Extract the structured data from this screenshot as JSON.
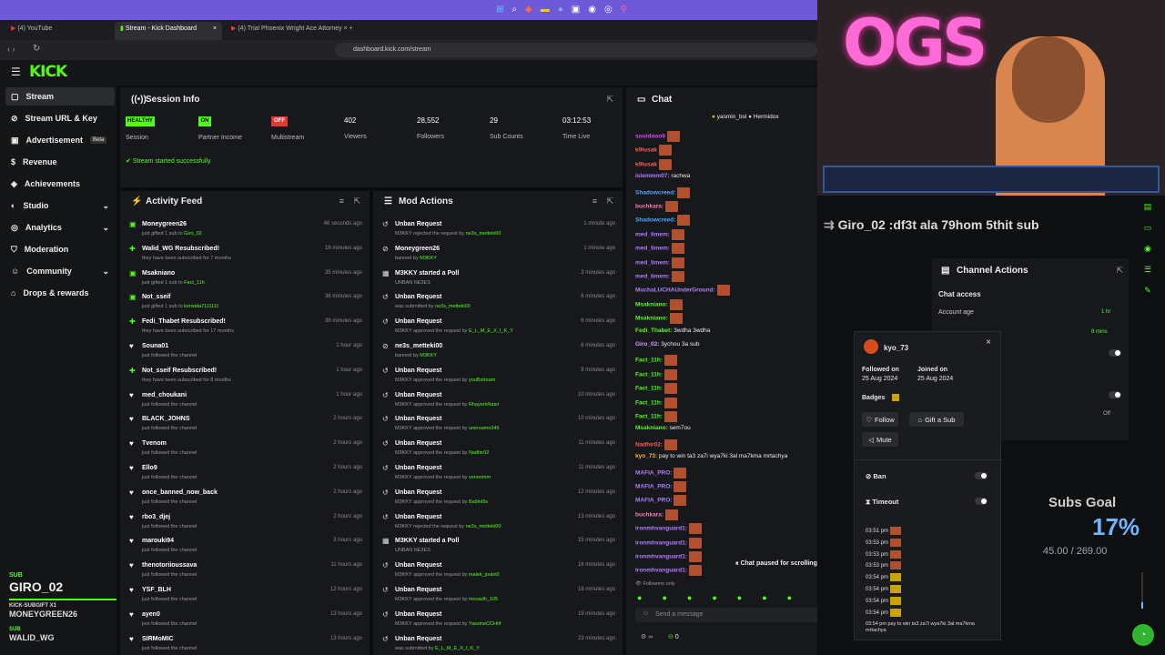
{
  "browser": {
    "tabs": [
      "(4) YouTube",
      "Stream - Kick Dashboard",
      "(4) Trial Phoenix Wright Ace Attorney"
    ],
    "url": "dashboard.kick.com/stream"
  },
  "brand": {
    "logo": "KICK",
    "accent": "#53fc18"
  },
  "sidebar": {
    "items": [
      {
        "label": "Stream"
      },
      {
        "label": "Stream URL & Key"
      },
      {
        "label": "Advertisement",
        "badge": "Beta"
      },
      {
        "label": "Revenue"
      },
      {
        "label": "Achievements"
      },
      {
        "label": "Studio"
      },
      {
        "label": "Analytics"
      },
      {
        "label": "Moderation"
      },
      {
        "label": "Community"
      },
      {
        "label": "Drops & rewards"
      }
    ]
  },
  "session": {
    "title": "Session Info",
    "stats": [
      {
        "badge": "HEALTHY",
        "label": "Session"
      },
      {
        "badge": "ON",
        "label": "Partner Income"
      },
      {
        "badge": "OFF",
        "label": "Multistream"
      },
      {
        "value": "402",
        "label": "Viewers"
      },
      {
        "value": "28,552",
        "label": "Followers"
      },
      {
        "value": "29",
        "label": "Sub Counts"
      },
      {
        "value": "03:12:53",
        "label": "Time Live"
      }
    ],
    "status": "Stream started successfully."
  },
  "activity": {
    "title": "Activity Feed",
    "rows": [
      {
        "t": "Moneygreen26",
        "s": "just gifted 1 sub to",
        "h": "Giro_02",
        "time": "46 seconds ago"
      },
      {
        "t": "Walid_WG Resubscribed!",
        "s": "they have been subscribed for 7 months",
        "time": "18 minutes ago"
      },
      {
        "t": "Msakniano",
        "s": "just gifted 1 sub to",
        "h": "Fact_11h",
        "time": "35 minutes ago"
      },
      {
        "t": "Not_sseif",
        "s": "just gifted 1 sub to",
        "h": "kerwida7111111",
        "time": "38 minutes ago"
      },
      {
        "t": "Fedi_Thabet Resubscribed!",
        "s": "they have been subscribed for 17 months",
        "time": "38 minutes ago"
      },
      {
        "t": "Souna01",
        "s": "just followed the channel",
        "time": "1 hour ago"
      },
      {
        "t": "Not_sseif Resubscribed!",
        "s": "they have been subscribed for 8 months",
        "time": "1 hour ago"
      },
      {
        "t": "med_choukani",
        "s": "just followed the channel",
        "time": "1 hour ago"
      },
      {
        "t": "BLACK_JOHNS",
        "s": "just followed the channel",
        "time": "2 hours ago"
      },
      {
        "t": "Tvenom",
        "s": "just followed the channel",
        "time": "2 hours ago"
      },
      {
        "t": "Ello9",
        "s": "just followed the channel",
        "time": "2 hours ago"
      },
      {
        "t": "once_banned_now_back",
        "s": "just followed the channel",
        "time": "2 hours ago"
      },
      {
        "t": "rbo3_djej",
        "s": "just followed the channel",
        "time": "2 hours ago"
      },
      {
        "t": "marouki94",
        "s": "just followed the channel",
        "time": "3 hours ago"
      },
      {
        "t": "thenotoriioussava",
        "s": "just followed the channel",
        "time": "11 hours ago"
      },
      {
        "t": "YSF_BLH",
        "s": "just followed the channel",
        "time": "12 hours ago"
      },
      {
        "t": "ayen0",
        "s": "just followed the channel",
        "time": "13 hours ago"
      },
      {
        "t": "SIRMoMIC",
        "s": "just followed the channel",
        "time": "13 hours ago"
      }
    ]
  },
  "mod": {
    "title": "Mod Actions",
    "rows": [
      {
        "t": "Unban Request",
        "s": "M3KKY rejected the request by",
        "h": "ne3s_metteki00",
        "time": "1 minute ago"
      },
      {
        "t": "Moneygreen26",
        "s": "banned by",
        "h": "M3KKY",
        "time": "1 minute ago"
      },
      {
        "t": "M3KKY started a Poll",
        "s": "UNBAN NE3ES",
        "time": "3 minutes ago"
      },
      {
        "t": "Unban Request",
        "s": "was submitted by",
        "h": "ne3s_metteki00",
        "time": "6 minutes ago"
      },
      {
        "t": "Unban Request",
        "s": "M3KKY approved the request by",
        "h": "E_L_M_E_X_I_K_Y",
        "time": "6 minutes ago"
      },
      {
        "t": "ne3s_metteki00",
        "s": "banned by",
        "h": "M3KKY",
        "time": "6 minutes ago"
      },
      {
        "t": "Unban Request",
        "s": "M3KKY approved the request by",
        "h": "youBstream",
        "time": "9 minutes ago"
      },
      {
        "t": "Unban Request",
        "s": "M3KKY approved the request by",
        "h": "RhayemNasri",
        "time": "10 minutes ago"
      },
      {
        "t": "Unban Request",
        "s": "M3KKY approved the request by",
        "h": "unersame345",
        "time": "10 minutes ago"
      },
      {
        "t": "Unban Request",
        "s": "M3KKY approved the request by",
        "h": "Nadhir02",
        "time": "11 minutes ago"
      },
      {
        "t": "Unban Request",
        "s": "M3KKY approved the request by",
        "h": "venoomm",
        "time": "11 minutes ago"
      },
      {
        "t": "Unban Request",
        "s": "M3KKY approved the request by",
        "h": "Ba9ini9s",
        "time": "12 minutes ago"
      },
      {
        "t": "Unban Request",
        "s": "M3KKY rejected the request by",
        "h": "ne3s_metteki00",
        "time": "13 minutes ago"
      },
      {
        "t": "M3KKY started a Poll",
        "s": "UNBAN NE3ES",
        "time": "15 minutes ago"
      },
      {
        "t": "Unban Request",
        "s": "M3KKY approved the request by",
        "h": "malek_jouini0",
        "time": "16 minutes ago"
      },
      {
        "t": "Unban Request",
        "s": "M3KKY approved the request by",
        "h": "mouadh_105",
        "time": "18 minutes ago"
      },
      {
        "t": "Unban Request",
        "s": "M3KKY approved the request by",
        "h": "YassineCCHrif",
        "time": "19 minutes ago"
      },
      {
        "t": "Unban Request",
        "s": "was submitted by",
        "h": "E_L_M_E_X_I_K_Y",
        "time": "23 minutes ago"
      }
    ]
  },
  "chat": {
    "title": "Chat",
    "pinned": [
      "yasmin_bsl",
      "Hermidox"
    ],
    "lines": [
      {
        "u": "souidooo9",
        "c": "#e040fb",
        "m": ""
      },
      {
        "u": "k9lusak",
        "c": "#ff5c5c",
        "m": ""
      },
      {
        "u": "k9lusak",
        "c": "#ff5c5c",
        "m": ""
      },
      {
        "u": "islemmm07:",
        "c": "#b07cff",
        "m": " rachwa"
      },
      {
        "u": "Shadowcreed:",
        "c": "#4da6ff",
        "m": ""
      },
      {
        "u": "buchkara:",
        "c": "#ff7ab0",
        "m": ""
      },
      {
        "u": "Shadowcreed:",
        "c": "#4da6ff",
        "m": ""
      },
      {
        "u": "med_limem:",
        "c": "#b07cff",
        "m": ""
      },
      {
        "u": "med_limem:",
        "c": "#b07cff",
        "m": ""
      },
      {
        "u": "med_limem:",
        "c": "#b07cff",
        "m": ""
      },
      {
        "u": "med_limem:",
        "c": "#b07cff",
        "m": ""
      },
      {
        "u": "MuchaLUCHAUnderGround:",
        "c": "#b07cff",
        "m": ""
      },
      {
        "u": "Msakniano:",
        "c": "#53fc18",
        "m": ""
      },
      {
        "u": "Msakniano:",
        "c": "#53fc18",
        "m": ""
      },
      {
        "u": "Fedi_Thabet:",
        "c": "#53fc18",
        "m": " 3wdha 3wdha"
      },
      {
        "u": "Giro_02:",
        "c": "#d59cff",
        "m": " 3ychou 3a sub"
      },
      {
        "u": "Fact_11h:",
        "c": "#53fc18",
        "m": ""
      },
      {
        "u": "Fact_11h:",
        "c": "#53fc18",
        "m": ""
      },
      {
        "u": "Fact_11h:",
        "c": "#53fc18",
        "m": ""
      },
      {
        "u": "Fact_11h:",
        "c": "#53fc18",
        "m": ""
      },
      {
        "u": "Fact_11h:",
        "c": "#53fc18",
        "m": ""
      },
      {
        "u": "Msakniano:",
        "c": "#53fc18",
        "m": " sem7ou"
      },
      {
        "u": "Nadhir02:",
        "c": "#ff5c5c",
        "m": ""
      },
      {
        "u": "kyo_73:",
        "c": "#ffb13b",
        "m": " pay to win ta3 za7i wya7ki 3al ma7kma mrtachya"
      },
      {
        "u": "MAFIA_PRO:",
        "c": "#b07cff",
        "m": ""
      },
      {
        "u": "MAFIA_PRO:",
        "c": "#b07cff",
        "m": ""
      },
      {
        "u": "MAFIA_PRO:",
        "c": "#b07cff",
        "m": ""
      },
      {
        "u": "buchkara:",
        "c": "#ff7ab0",
        "m": ""
      },
      {
        "u": "ironmhvanguard1:",
        "c": "#b07cff",
        "m": ""
      },
      {
        "u": "ironmhvanguard1:",
        "c": "#b07cff",
        "m": ""
      },
      {
        "u": "ironmhvanguard1:",
        "c": "#b07cff",
        "m": ""
      },
      {
        "u": "ironmhvanguard1:",
        "c": "#b07cff",
        "m": ""
      }
    ],
    "paused": "Chat paused for scrolling",
    "followers_only": "Followers only",
    "placeholder": "Send a message",
    "count": "0"
  },
  "profile": {
    "name": "kyo_73",
    "followed_label": "Followed on",
    "followed": "25 Aug 2024",
    "joined_label": "Joined on",
    "joined": "25 Aug 2024",
    "badges": "Badges",
    "follow": "Follow",
    "gift": "Gift a Sub",
    "mute": "Mute",
    "ban": "Ban",
    "timeout": "Timeout",
    "times": [
      "03:51 pm",
      "03:53 pm",
      "03:53 pm",
      "03:53 pm",
      "03:54 pm",
      "03:54 pm",
      "03:54 pm",
      "03:54 pm"
    ],
    "last_msg": "03:54 pm pay to win ta3 za7i wya7ki 3al ma7kma mrtachya"
  },
  "channel_actions": {
    "title": "Channel Actions",
    "chat_access": "Chat access",
    "account_age": "Account age",
    "age_val": "1 hr",
    "mins": "8 mins",
    "off": "Off"
  },
  "overlay": {
    "sub_text": "Giro_02 :df3t ala 79hom 5thit sub",
    "goal_title": "Subs Goal",
    "goal_pct": "17%",
    "goal_progress": "45.00 / 269.00",
    "goal_fraction": 0.17,
    "alert_label": "SUB",
    "alert_user": "GIRO_02",
    "alert_line": "KICK-SUBGIFT X1",
    "alert_user2": "MONEYGREEN26",
    "alert_label2": "SUB",
    "alert_user3": "WALID_WG"
  }
}
